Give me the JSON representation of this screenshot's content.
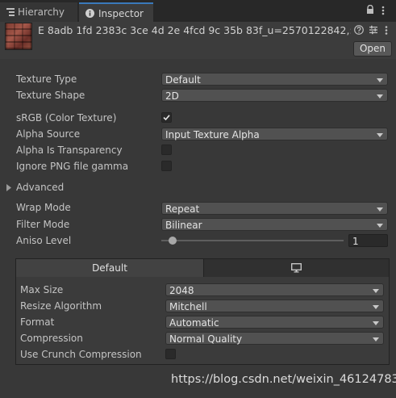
{
  "tabs": {
    "hierarchy": "Hierarchy",
    "inspector": "Inspector"
  },
  "header": {
    "asset_name": "E 8adb 1fd 2383c 3ce 4d 2e 4fcd 9c 35b 83f_u=2570122842,:",
    "open_label": "Open"
  },
  "import": {
    "texture_type": {
      "label": "Texture Type",
      "value": "Default"
    },
    "texture_shape": {
      "label": "Texture Shape",
      "value": "2D"
    },
    "srgb": {
      "label": "sRGB (Color Texture)",
      "checked": true
    },
    "alpha_source": {
      "label": "Alpha Source",
      "value": "Input Texture Alpha"
    },
    "alpha_is_transparency": {
      "label": "Alpha Is Transparency",
      "checked": false
    },
    "ignore_png_gamma": {
      "label": "Ignore PNG file gamma",
      "checked": false
    },
    "advanced": {
      "label": "Advanced"
    },
    "wrap_mode": {
      "label": "Wrap Mode",
      "value": "Repeat"
    },
    "filter_mode": {
      "label": "Filter Mode",
      "value": "Bilinear"
    },
    "aniso_level": {
      "label": "Aniso Level",
      "value": "1",
      "fraction": 0.0625
    }
  },
  "platform": {
    "tab_default": "Default",
    "max_size": {
      "label": "Max Size",
      "value": "2048"
    },
    "resize_algorithm": {
      "label": "Resize Algorithm",
      "value": "Mitchell"
    },
    "format": {
      "label": "Format",
      "value": "Automatic"
    },
    "compression": {
      "label": "Compression",
      "value": "Normal Quality"
    },
    "crunch": {
      "label": "Use Crunch Compression",
      "checked": false
    }
  },
  "watermark": "https://blog.csdn.net/weixin_46124783"
}
